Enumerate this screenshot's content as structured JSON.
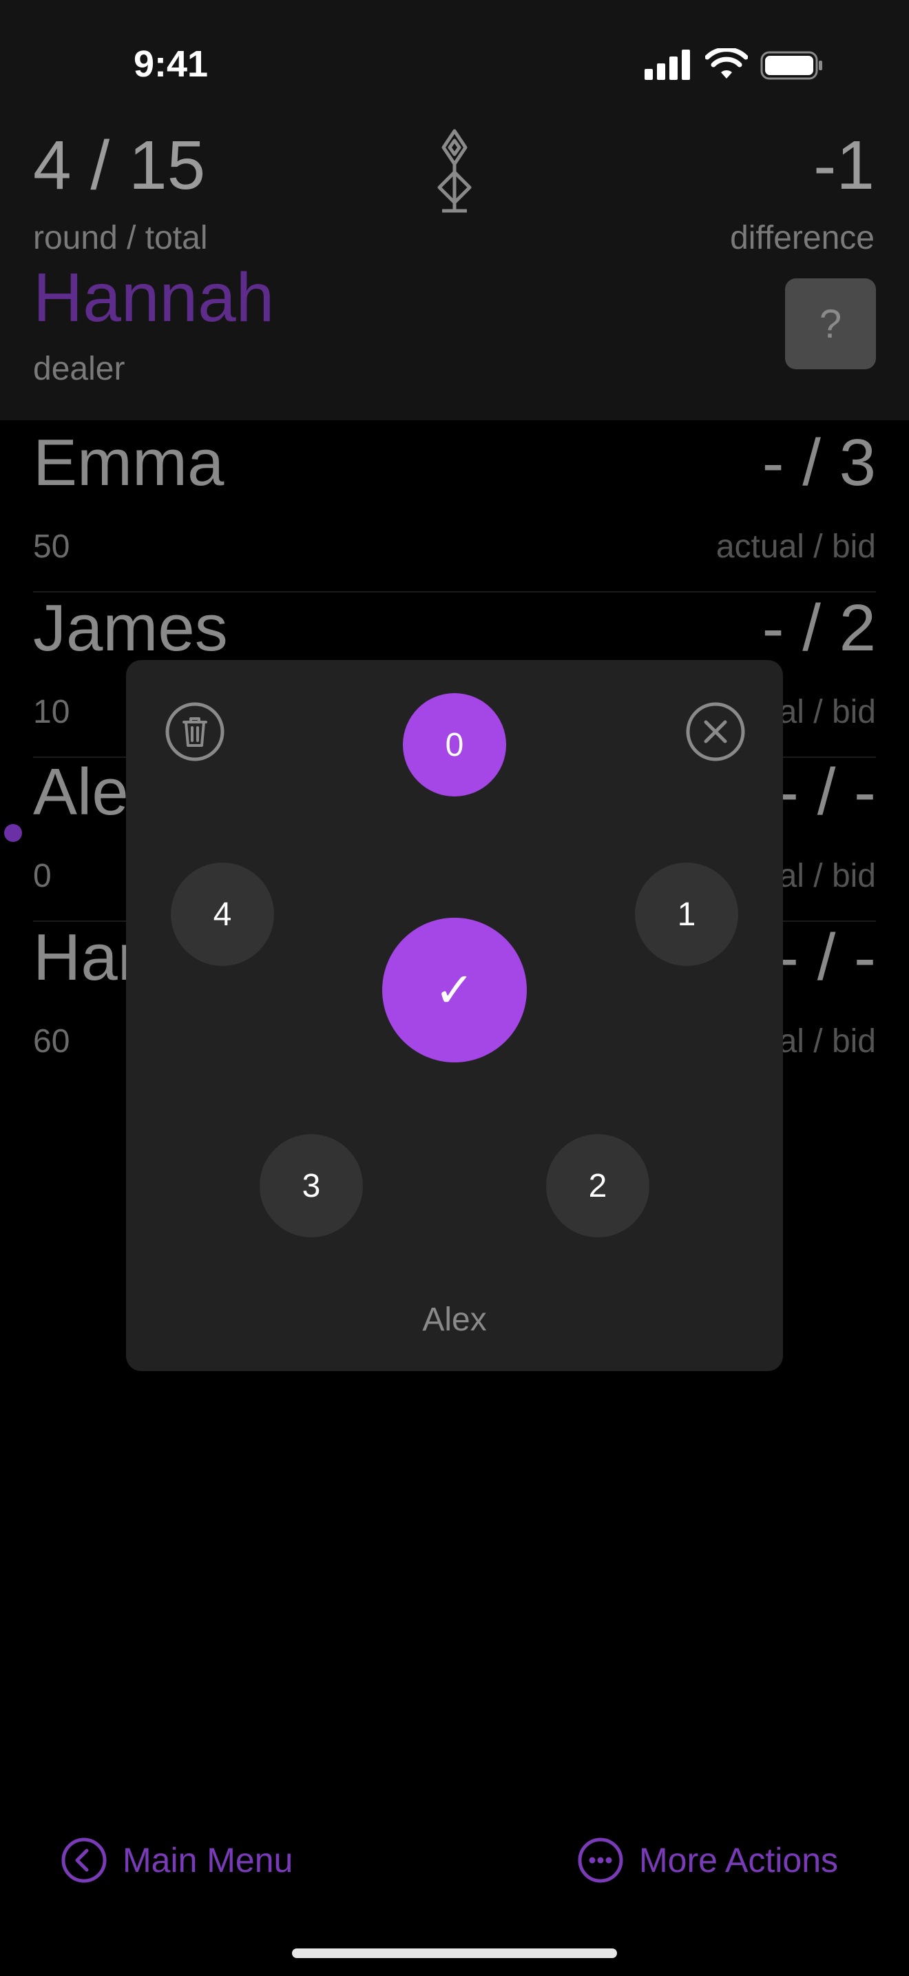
{
  "status_bar": {
    "time": "9:41"
  },
  "header": {
    "round": "4 / 15",
    "round_label": "round / total",
    "difference": "-1",
    "difference_label": "difference",
    "dealer_name": "Hannah",
    "dealer_label": "dealer",
    "help_label": "?"
  },
  "players": [
    {
      "name": "Emma",
      "score": "50",
      "bid": "- / 3",
      "label": "actual / bid"
    },
    {
      "name": "James",
      "score": "10",
      "bid": "- / 2",
      "label": "actual / bid"
    },
    {
      "name": "Alex",
      "score": "0",
      "bid": "- / -",
      "label": "actual / bid"
    },
    {
      "name": "Hannah",
      "score": "60",
      "bid": "- / -",
      "label": "actual / bid"
    }
  ],
  "picker": {
    "options": [
      "0",
      "1",
      "2",
      "3",
      "4"
    ],
    "selected": "0",
    "confirm_label": "✓",
    "player_name": "Alex"
  },
  "bottom_bar": {
    "main_menu": "Main Menu",
    "more_actions": "More Actions"
  },
  "colors": {
    "accent": "#a546e6",
    "accent_dim": "#7a3bb8",
    "dealer": "#5e2d8c"
  }
}
